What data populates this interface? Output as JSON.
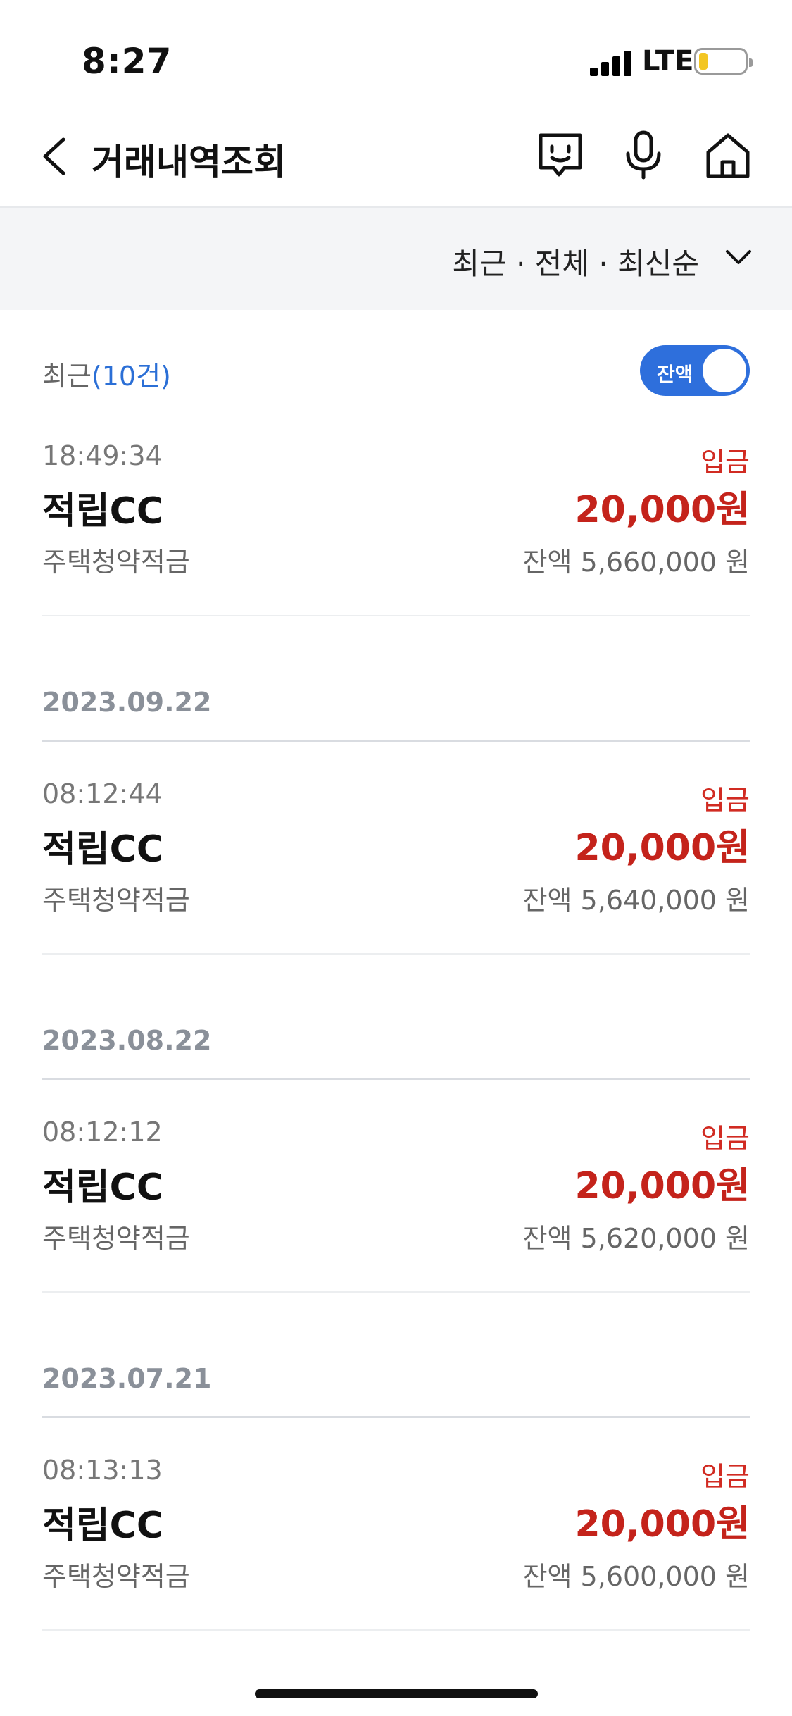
{
  "status_bar": {
    "time": "8:27",
    "network": "LTE",
    "battery_level": 0.2
  },
  "header": {
    "title": "거래내역조회"
  },
  "filter": {
    "label": "최근 · 전체 · 최신순"
  },
  "summary": {
    "prefix": "최근",
    "count": "(10건)"
  },
  "toggle": {
    "label": "잔액",
    "on": true
  },
  "colors": {
    "accent": "#2e6fdc",
    "deposit": "#c4231b",
    "date": "#8a9099"
  },
  "transactions": [
    {
      "time": "18:49:34",
      "type": "입금",
      "name": "적립CC",
      "amount": "20,000원",
      "account": "주택청약적금",
      "balance": "잔액 5,660,000 원"
    },
    {
      "time": "08:12:44",
      "type": "입금",
      "name": "적립CC",
      "amount": "20,000원",
      "account": "주택청약적금",
      "balance": "잔액 5,640,000 원"
    },
    {
      "time": "08:12:12",
      "type": "입금",
      "name": "적립CC",
      "amount": "20,000원",
      "account": "주택청약적금",
      "balance": "잔액 5,620,000 원"
    },
    {
      "time": "08:13:13",
      "type": "입금",
      "name": "적립CC",
      "amount": "20,000원",
      "account": "주택청약적금",
      "balance": "잔액 5,600,000 원"
    }
  ],
  "dates": [
    "2023.09.22",
    "2023.08.22",
    "2023.07.21"
  ]
}
